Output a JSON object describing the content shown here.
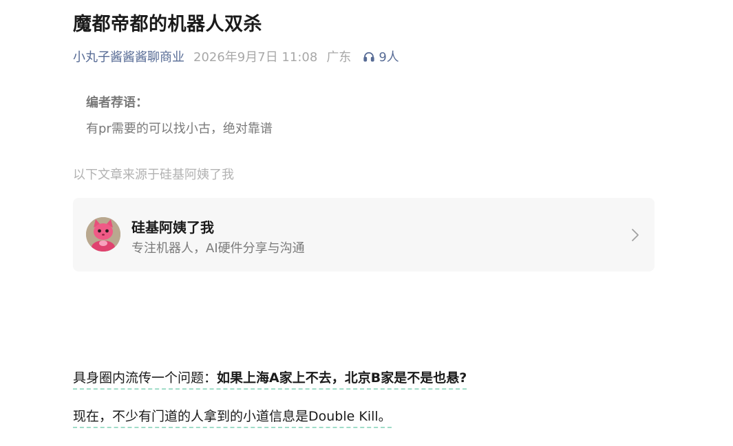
{
  "article": {
    "title": "魔都帝都的机器人双杀",
    "author": "小丸子酱酱酱聊商业",
    "date": "2026年9月7日 11:08",
    "region": "广东",
    "listeners": "9人"
  },
  "editor_note": {
    "label": "编者荐语：",
    "text": "有pr需要的可以找小古，绝对靠谱"
  },
  "source_note": "以下文章来源于硅基阿姨了我",
  "profile_card": {
    "name": "硅基阿姨了我",
    "description": "专注机器人，AI硬件分享与沟通"
  },
  "body": {
    "para1_plain": "具身圈内流传一个问题：",
    "para1_bold": "如果上海A家上不去，北京B家是不是也悬?",
    "para2": "现在，不少有门道的人拿到的小道信息是Double Kill。"
  },
  "icons": {
    "listen": "headphones-icon",
    "chevron": "chevron-right-icon",
    "avatar": "pink-cat-avatar"
  },
  "colors": {
    "link": "#576b95",
    "meta_gray": "#a8a8a8",
    "card_bg": "#f7f7f7",
    "underline": "#9fdcc8",
    "avatar_pink": "#e8507a"
  }
}
